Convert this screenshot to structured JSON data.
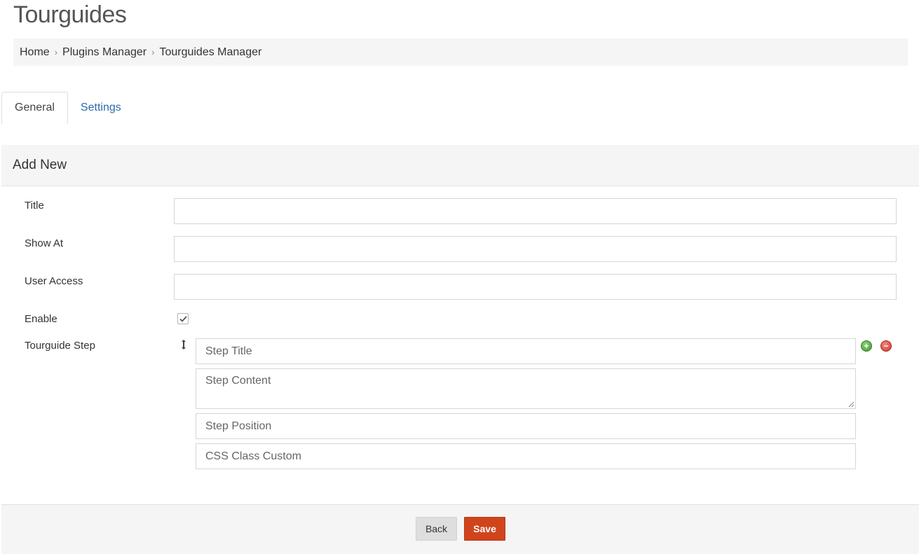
{
  "page": {
    "title": "Tourguides"
  },
  "breadcrumb": {
    "items": [
      "Home",
      "Plugins Manager",
      "Tourguides Manager"
    ],
    "separator": "›"
  },
  "tabs": [
    {
      "label": "General",
      "active": true
    },
    {
      "label": "Settings",
      "active": false
    }
  ],
  "panel": {
    "heading": "Add New"
  },
  "form": {
    "title": {
      "label": "Title",
      "value": ""
    },
    "show_at": {
      "label": "Show At",
      "value": ""
    },
    "user_access": {
      "label": "User Access",
      "value": ""
    },
    "enable": {
      "label": "Enable",
      "checked": true
    },
    "tourguide_step": {
      "label": "Tourguide Step",
      "step_title_placeholder": "Step Title",
      "step_content_placeholder": "Step Content",
      "step_position_placeholder": "Step Position",
      "css_class_placeholder": "CSS Class Custom"
    }
  },
  "actions": {
    "back_label": "Back",
    "save_label": "Save"
  },
  "colors": {
    "accent": "#d0441c",
    "link": "#2a6ab0",
    "add_green": "#3c9a2c",
    "remove_red": "#d2352a"
  },
  "icons": [
    "drag-handle-icon",
    "add-step-icon",
    "remove-step-icon",
    "checkmark-icon",
    "resize-grip-icon"
  ]
}
